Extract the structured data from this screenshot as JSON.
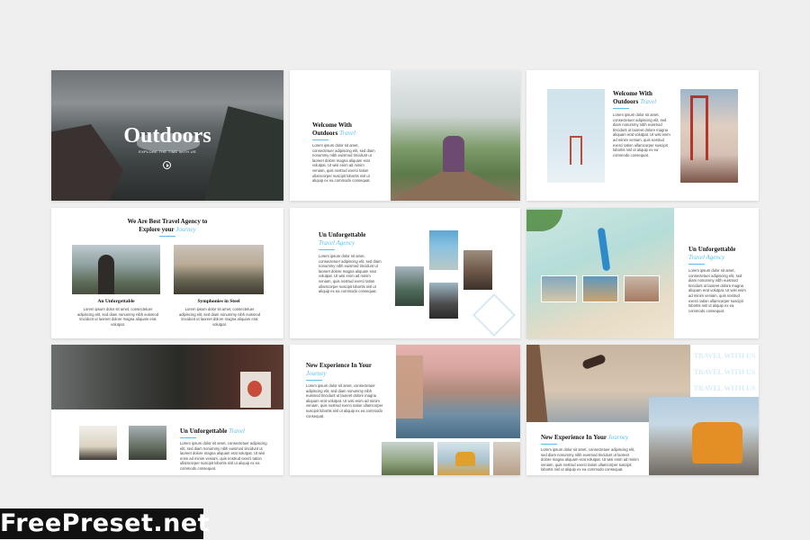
{
  "slides": {
    "s1": {
      "title": "Outdoors",
      "subtitle": "EXPLORE THE TIME WITH US"
    },
    "s2": {
      "title": "Welcome With",
      "title2": "Outdoors",
      "accent": "Travel",
      "body": "Lorem ipsum dolor sit amet, consectetuer adipiscing elit, sed diam nonummy nibh euismod tincidunt ut laoreet dolore magna aliquam erat volutpat. Ut wisi enim ad minim veniam, quis nostrud exerci tation ullamcorper suscipit lobortis nisl ut aliquip ex ea commodo consequat."
    },
    "s3": {
      "title": "Welcome With",
      "title2": "Outdoors",
      "accent": "Travel",
      "body": "Lorem ipsum dolor sit amet, consectetuer adipiscing elit, sed diam nonummy nibh euismod tincidunt ut laoreet dolore magna aliquam erat volutpat. Ut wisi enim ad minim veniam, quis nostrud exerci tation ullamcorper suscipit lobortis nisl ut aliquip ex ea commodo consequat."
    },
    "s4": {
      "title": "We Are Best Travel Agency to",
      "title2": "Explore your",
      "accent": "Journey",
      "cap1": "An Unforgettable",
      "cap2": "Symphonies in Steel",
      "body": "Lorem ipsum dolor sit amet, consectetuer adipiscing elit, sed diam nonummy nibh euismod tincidunt ut laoreet dolore magna aliquam erat volutpat."
    },
    "s5": {
      "title": "Un Unforgettable",
      "accent": "Travel Agency",
      "body": "Lorem ipsum dolor sit amet, consectetuer adipiscing elit, sed diam nonummy nibh euismod tincidunt ut laoreet dolore magna aliquam erat volutpat. Ut wisi enim ad minim veniam, quis nostrud exerci tation ullamcorper suscipit lobortis nisl ut aliquip ex ea commodo consequat."
    },
    "s6": {
      "title": "Un Unforgettable",
      "accent": "Travel Agency",
      "body": "Lorem ipsum dolor sit amet, consectetuer adipiscing elit, sed diam nonummy nibh euismod tincidunt ut laoreet dolore magna aliquam erat volutpat. Ut wisi enim ad minim veniam, quis nostrud exerci tation ullamcorper suscipit lobortis nisl ut aliquip ex ea commodo consequat."
    },
    "s7": {
      "title": "Un Unforgettable",
      "accent": "Travel",
      "body": "Lorem ipsum dolor sit amet, consectetuer adipiscing elit, sed diam nonummy nibh euismod tincidunt ut laoreet dolore magna aliquam erat volutpat. Ut wisi enim ad minim veniam, quis nostrud exerci tation ullamcorper suscipit lobortis nisl ut aliquip ex ea commodo consequat."
    },
    "s8": {
      "title": "New Experience In Your",
      "accent": "Journey",
      "body": "Lorem ipsum dolor sit amet, consectetuer adipiscing elit, sed diam nonummy nibh euismod tincidunt ut laoreet dolore magna aliquam erat volutpat. Ut wisi enim ad minim veniam, quis nostrud exerci tation ullamcorper suscipit lobortis nisl ut aliquip ex ea commodo consequat."
    },
    "s9": {
      "title": "New Experience In Your",
      "accent": "Journey",
      "repeat": [
        "TRAVEL WITH US",
        "TRAVEL WITH US",
        "TRAVEL WITH US"
      ],
      "body": "Lorem ipsum dolor sit amet, consectetuer adipiscing elit, sed diam nonummy nibh euismod tincidunt ut laoreet dolore magna aliquam erat volutpat. Ut wisi enim ad minim veniam, quis nostrud exerci tation ullamcorper suscipit lobortis nisl ut aliquip ex ea commodo consequat."
    }
  },
  "watermark": "FreePreset.net",
  "colors": {
    "accent": "#5bc0eb",
    "background": "#efefef"
  },
  "icons": {
    "play": "play-icon"
  }
}
